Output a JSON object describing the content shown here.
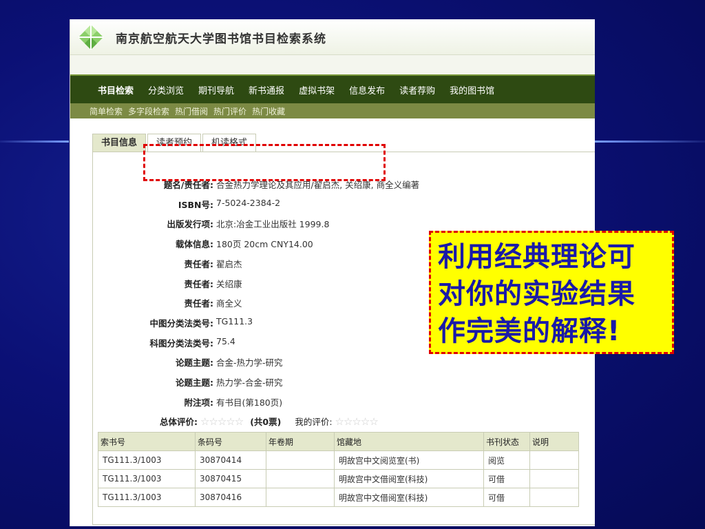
{
  "site": {
    "title": "南京航空航天大学图书馆书目检索系统"
  },
  "nav_main": [
    "书目检索",
    "分类浏览",
    "期刊导航",
    "新书通报",
    "虚拟书架",
    "信息发布",
    "读者荐购",
    "我的图书馆"
  ],
  "nav_sub": [
    "简单检索",
    "多字段检索",
    "热门借阅",
    "热门评价",
    "热门收藏"
  ],
  "tabs": [
    "书目信息",
    "读者预约",
    "机读格式"
  ],
  "fields": [
    {
      "label": "题名/责任者:",
      "value": "合金热力学理论及其应用/翟启杰, 关绍康, 商全义编著"
    },
    {
      "label": "ISBN号:",
      "value": "7-5024-2384-2"
    },
    {
      "label": "出版发行项:",
      "value": "北京:冶金工业出版社 1999.8"
    },
    {
      "label": "载体信息:",
      "value": "180页 20cm CNY14.00"
    },
    {
      "label": "责任者:",
      "value": "翟启杰"
    },
    {
      "label": "责任者:",
      "value": "关绍康"
    },
    {
      "label": "责任者:",
      "value": "商全义"
    },
    {
      "label": "中图分类法类号:",
      "value": "TG111.3"
    },
    {
      "label": "科图分类法类号:",
      "value": "75.4"
    },
    {
      "label": "论题主题:",
      "value": "合金-热力学-研究"
    },
    {
      "label": "论题主题:",
      "value": "热力学-合金-研究"
    },
    {
      "label": "附注项:",
      "value": "有书目(第180页)"
    }
  ],
  "rating": {
    "label": "总体评价:",
    "stars": "☆☆☆☆☆",
    "votes": "(共0票)",
    "my_label": "我的评价:",
    "my_stars": "☆☆☆☆☆"
  },
  "holdings": {
    "headers": [
      "索书号",
      "条码号",
      "年卷期",
      "馆藏地",
      "书刊状态",
      "说明"
    ],
    "rows": [
      [
        "TG111.3/1003",
        "30870414",
        "",
        "明故宫中文阅览室(书)",
        "阅览",
        ""
      ],
      [
        "TG111.3/1003",
        "30870415",
        "",
        "明故宫中文借阅室(科技)",
        "可借",
        ""
      ],
      [
        "TG111.3/1003",
        "30870416",
        "",
        "明故宫中文借阅室(科技)",
        "可借",
        ""
      ]
    ]
  },
  "callout": {
    "lines": [
      "利用经典理论可",
      "对你的实验结果",
      "作完美的解释!"
    ]
  },
  "colors": {
    "nav_dark": "#2e4a12",
    "nav_sub": "#7c8a44",
    "callout_bg": "#ffff00",
    "callout_text": "#1a1aa8",
    "highlight": "#e00000",
    "slide_bg": "#0a0f6e"
  }
}
